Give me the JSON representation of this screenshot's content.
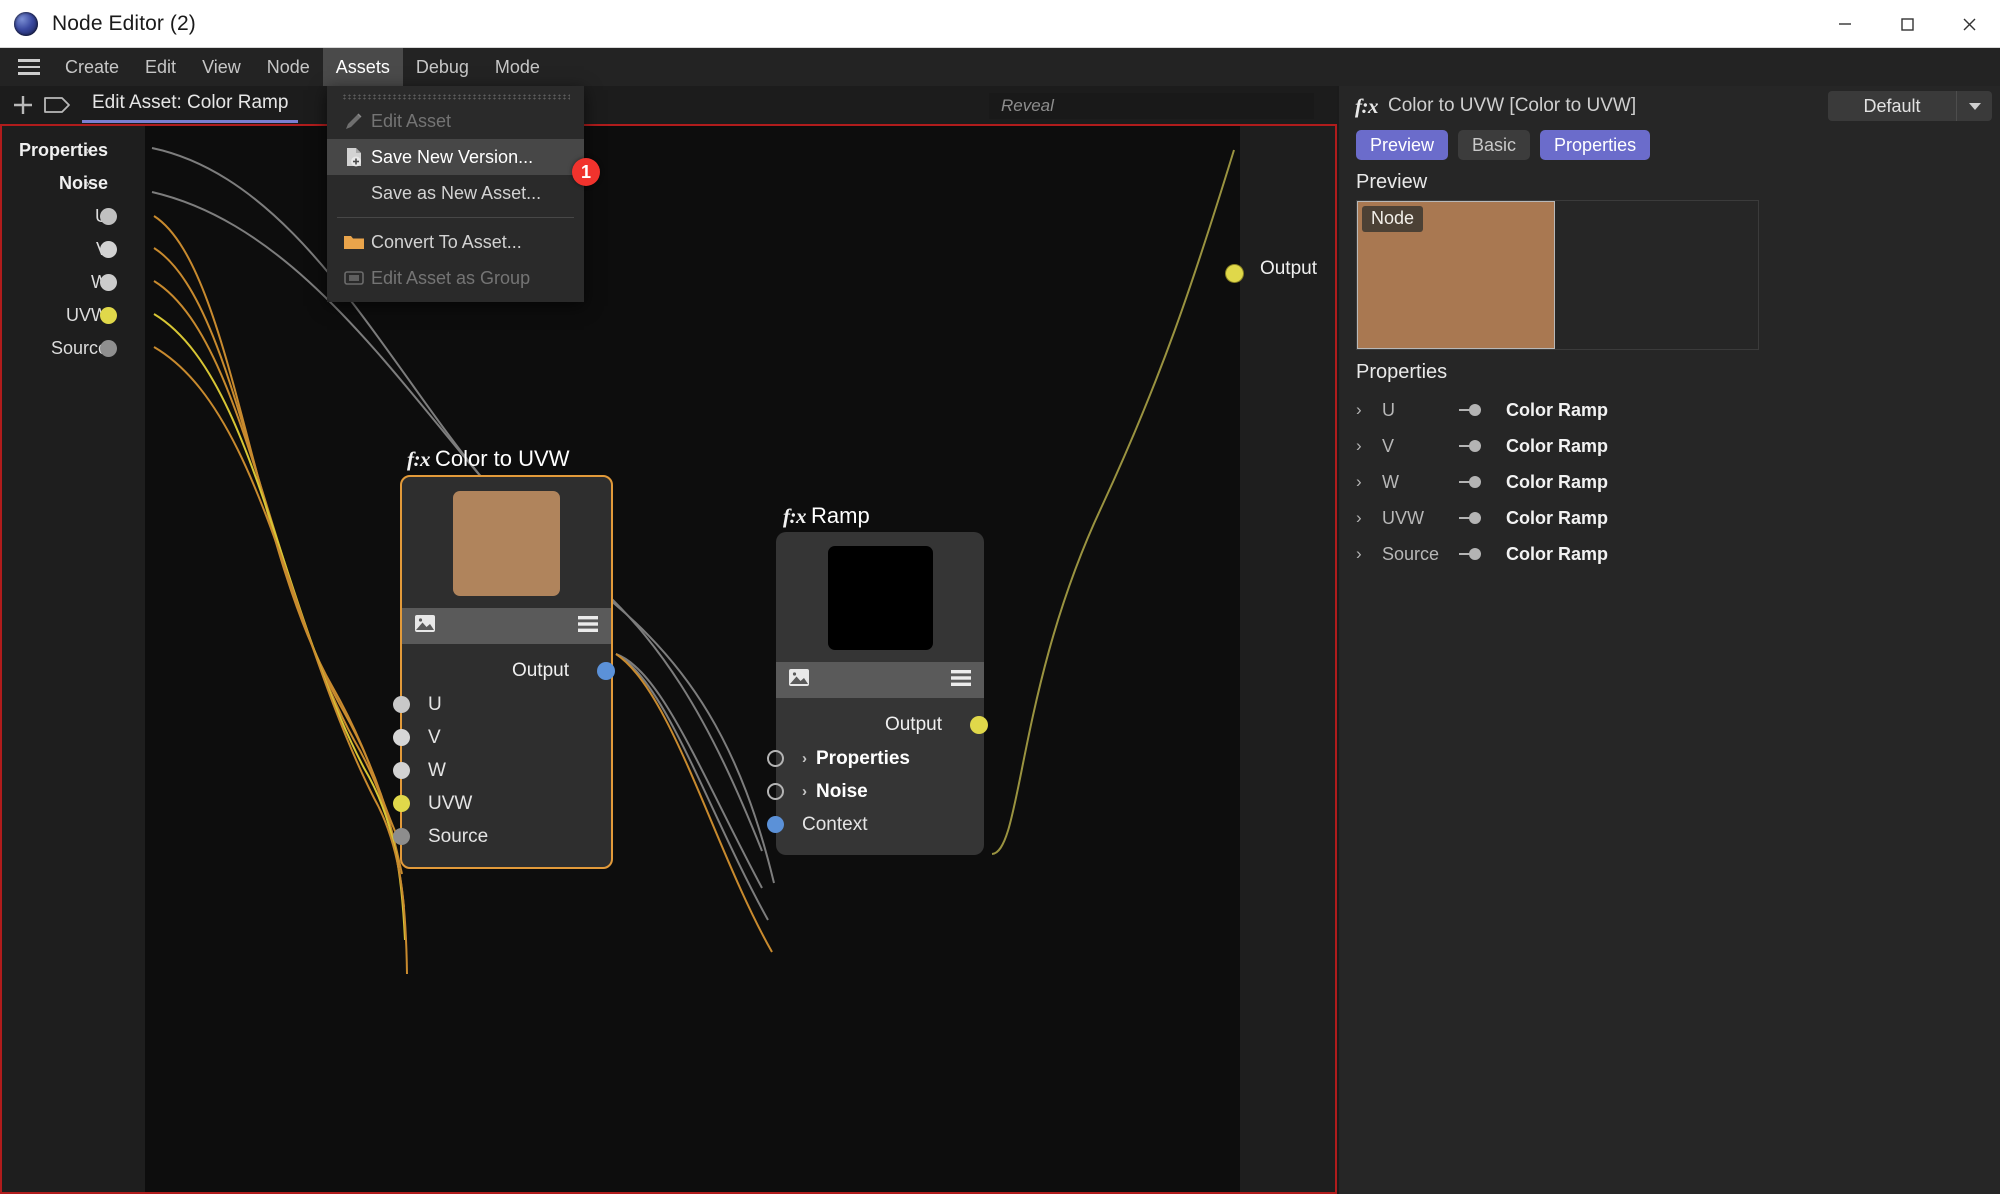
{
  "window": {
    "title": "Node Editor (2)",
    "logo_icon": "node-editor-logo",
    "controls": [
      {
        "name": "minimize-button",
        "icon": "minimize-icon"
      },
      {
        "name": "maximize-button",
        "icon": "maximize-icon"
      },
      {
        "name": "close-button",
        "icon": "close-icon"
      }
    ]
  },
  "menubar": {
    "hamburger_icon": "hamburger-icon",
    "items": [
      {
        "label": "Create",
        "active": false
      },
      {
        "label": "Edit",
        "active": false
      },
      {
        "label": "View",
        "active": false
      },
      {
        "label": "Node",
        "active": false
      },
      {
        "label": "Assets",
        "active": true
      },
      {
        "label": "Debug",
        "active": false
      },
      {
        "label": "Mode",
        "active": false
      }
    ]
  },
  "toolbar": {
    "add_icon": "plus-icon",
    "tag_icon": "tag-icon",
    "asset_tab_label": "Edit Asset: Color Ramp",
    "reveal_placeholder": "Reveal"
  },
  "assets_menu": {
    "grip_icon": "drag-grip-icon",
    "items": [
      {
        "label": "Edit Asset",
        "icon": "pencil-icon",
        "state": "disabled"
      },
      {
        "label": "Save New Version...",
        "icon": "save-new-version-icon",
        "state": "selected"
      },
      {
        "label": "Save as New Asset...",
        "icon": "none",
        "state": "normal"
      },
      {
        "label": "Convert To Asset...",
        "icon": "folder-icon",
        "state": "normal"
      },
      {
        "label": "Edit Asset as Group",
        "icon": "group-icon",
        "state": "disabled"
      }
    ],
    "badge": "1"
  },
  "canvas": {
    "left_params": {
      "rows": [
        {
          "label": "Properties",
          "bold": true,
          "chevron": true,
          "socket": "none"
        },
        {
          "label": "Noise",
          "bold": true,
          "chevron": true,
          "socket": "none"
        },
        {
          "label": "U",
          "bold": false,
          "chevron": false,
          "socket": "#c0c0c0"
        },
        {
          "label": "V",
          "bold": false,
          "chevron": false,
          "socket": "#d2d2d2"
        },
        {
          "label": "W",
          "bold": false,
          "chevron": false,
          "socket": "#cccccc"
        },
        {
          "label": "UVW",
          "bold": false,
          "chevron": false,
          "socket": "#e0d84a"
        },
        {
          "label": "Source",
          "bold": false,
          "chevron": false,
          "socket": "#8f8f8f"
        }
      ]
    },
    "output_label": "Output",
    "nodes": [
      {
        "title": "Color to UVW",
        "fx": "f:x",
        "selected": true,
        "thumb_color": "#b0845c",
        "strip_left_icon": "image-icon",
        "strip_right_icon": "menu-lines-icon",
        "output_label": "Output",
        "output_socket_color": "#5b91d8",
        "inputs": [
          {
            "label": "U",
            "socket": "#c8c8c8",
            "bold": false,
            "chevron": false,
            "hollow": false
          },
          {
            "label": "V",
            "socket": "#d6d6d6",
            "bold": false,
            "chevron": false,
            "hollow": false
          },
          {
            "label": "W",
            "socket": "#d2d2d2",
            "bold": false,
            "chevron": false,
            "hollow": false
          },
          {
            "label": "UVW",
            "socket": "#e0d84a",
            "bold": false,
            "chevron": false,
            "hollow": false
          },
          {
            "label": "Source",
            "socket": "#8d8d8d",
            "bold": false,
            "chevron": false,
            "hollow": false
          }
        ]
      },
      {
        "title": "Ramp",
        "fx": "f:x",
        "selected": false,
        "thumb_color": "#000000",
        "strip_left_icon": "image-icon",
        "strip_right_icon": "menu-lines-icon",
        "output_label": "Output",
        "output_socket_color": "#e0d84a",
        "inputs": [
          {
            "label": "Properties",
            "socket": "#b4b4b4",
            "bold": true,
            "chevron": true,
            "hollow": true
          },
          {
            "label": "Noise",
            "socket": "#b4b4b4",
            "bold": true,
            "chevron": true,
            "hollow": true
          },
          {
            "label": "Context",
            "socket": "#5b91d8",
            "bold": false,
            "chevron": false,
            "hollow": false
          }
        ]
      }
    ]
  },
  "right_panel": {
    "fx": "f:x",
    "title": "Color to UVW [Color to UVW]",
    "preset_value": "Default",
    "preset_caret_icon": "chevron-down-icon",
    "tabs": [
      {
        "label": "Preview",
        "selected": true
      },
      {
        "label": "Basic",
        "selected": false
      },
      {
        "label": "Properties",
        "selected": true
      }
    ],
    "preview_heading": "Preview",
    "preview_node_chip": "Node",
    "preview_color": "#a97851",
    "properties_heading": "Properties",
    "properties": [
      {
        "chevron": "›",
        "name": "U",
        "value": "Color Ramp"
      },
      {
        "chevron": "›",
        "name": "V",
        "value": "Color Ramp"
      },
      {
        "chevron": "›",
        "name": "W",
        "value": "Color Ramp"
      },
      {
        "chevron": "›",
        "name": "UVW",
        "value": "Color Ramp"
      },
      {
        "chevron": "›",
        "name": "Source",
        "value": "Color Ramp"
      }
    ]
  },
  "colors": {
    "accent_purple": "#6b6ccb",
    "selection_orange": "#e29a3a",
    "error_red": "#b01c1c",
    "badge_red": "#f1332d",
    "wire_orange": "#c88a2e",
    "wire_yellow": "#9a9340",
    "wire_gray": "#7d7d7d"
  }
}
